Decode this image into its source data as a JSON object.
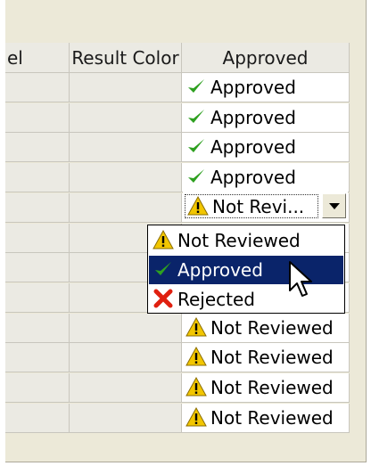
{
  "table": {
    "columns": [
      "el",
      "Result Color",
      "Approved"
    ],
    "rows": [
      {
        "approved": "Approved",
        "icon": "check-icon"
      },
      {
        "approved": "Approved",
        "icon": "check-icon"
      },
      {
        "approved": "Approved",
        "icon": "check-icon"
      },
      {
        "approved": "Approved",
        "icon": "check-icon"
      },
      {
        "approved": "Not Revi...",
        "icon": "warning-icon"
      },
      {
        "approved": "",
        "icon": ""
      },
      {
        "approved": "",
        "icon": ""
      },
      {
        "approved": "",
        "icon": ""
      },
      {
        "approved": "Not Reviewed",
        "icon": "warning-icon"
      },
      {
        "approved": "Not Reviewed",
        "icon": "warning-icon"
      },
      {
        "approved": "Not Reviewed",
        "icon": "warning-icon"
      },
      {
        "approved": "Not Reviewed",
        "icon": "warning-icon"
      }
    ]
  },
  "editor": {
    "value": "Not Revi...",
    "icon": "warning-icon"
  },
  "dropdown": {
    "options": [
      {
        "label": "Not Reviewed",
        "icon": "warning-icon",
        "selected": false
      },
      {
        "label": "Approved",
        "icon": "check-icon",
        "selected": true
      },
      {
        "label": "Rejected",
        "icon": "cross-icon",
        "selected": false
      }
    ]
  },
  "colors": {
    "selection": "#0a246a",
    "check": "#2ea020",
    "warning": "#f2c600",
    "cross": "#e02010"
  }
}
